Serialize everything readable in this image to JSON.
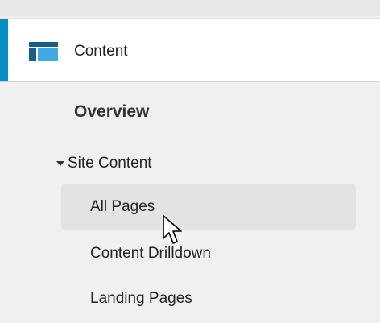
{
  "colors": {
    "accent": "#058dc7",
    "icon_dark": "#1a5c8c",
    "icon_light": "#41a8e0",
    "selected_bg": "#e3e3e3"
  },
  "section": {
    "label": "Content",
    "icon": "content-icon"
  },
  "overview": {
    "label": "Overview"
  },
  "group": {
    "label": "Site Content",
    "expanded": true,
    "icon": "caret-down-icon"
  },
  "items": [
    {
      "label": "All Pages",
      "selected": true
    },
    {
      "label": "Content Drilldown",
      "selected": false
    },
    {
      "label": "Landing Pages",
      "selected": false
    }
  ],
  "pointer": {
    "icon": "mouse-cursor-icon"
  }
}
